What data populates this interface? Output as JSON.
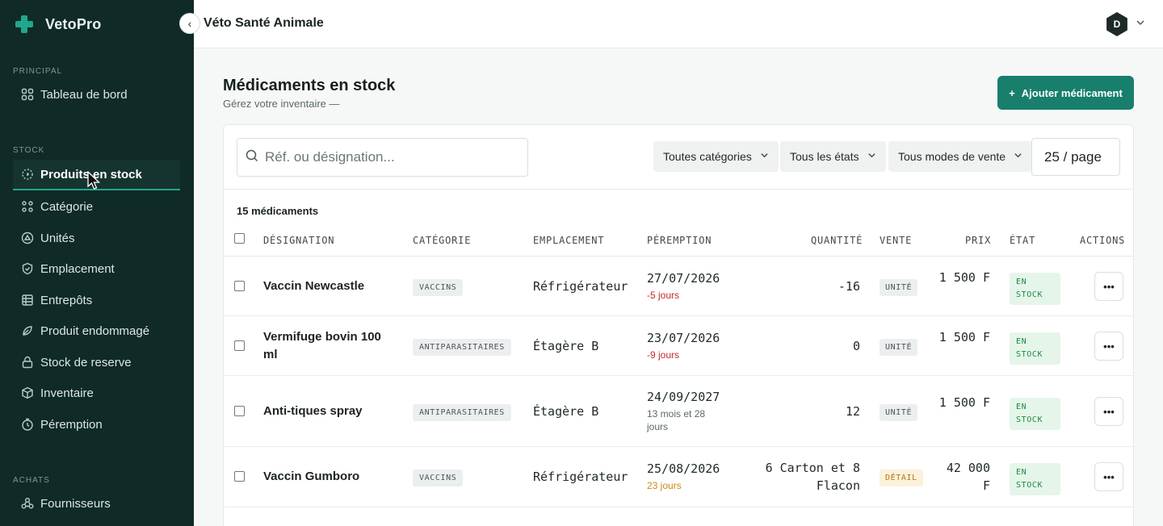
{
  "brand": {
    "name": "VetoPro"
  },
  "topbar": {
    "clinic": "Véto Santé Animale",
    "avatar": "D"
  },
  "sidebar": {
    "sections": [
      {
        "label": "PRINCIPAL",
        "items": [
          {
            "label": "Tableau de bord",
            "icon": "grid-icon"
          }
        ]
      },
      {
        "label": "STOCK",
        "items": [
          {
            "label": "Produits en stock",
            "icon": "box-dashed-icon",
            "active": true
          },
          {
            "label": "Catégorie",
            "icon": "dots-grid-icon"
          },
          {
            "label": "Unités",
            "icon": "scale-icon"
          },
          {
            "label": "Emplacement",
            "icon": "location-icon"
          },
          {
            "label": "Entrepôts",
            "icon": "warehouse-icon"
          },
          {
            "label": "Produit endommagé",
            "icon": "broken-icon"
          },
          {
            "label": "Stock de reserve",
            "icon": "lock-icon"
          },
          {
            "label": "Inventaire",
            "icon": "cube-icon"
          },
          {
            "label": "Péremption",
            "icon": "clock-icon"
          }
        ]
      },
      {
        "label": "ACHATS",
        "items": [
          {
            "label": "Fournisseurs",
            "icon": "suppliers-icon"
          }
        ]
      }
    ]
  },
  "page": {
    "title": "Médicaments en stock",
    "subtitle": "Gérez votre inventaire —",
    "add_label": "Ajouter médicament"
  },
  "filters": {
    "search_placeholder": "Réf. ou désignation...",
    "category": "Toutes catégories",
    "state": "Tous les états",
    "sale_mode": "Tous modes de vente",
    "per_page": "25 / page"
  },
  "table": {
    "count": "15 médicaments",
    "headers": {
      "designation": "DÉSIGNATION",
      "categorie": "CATÉGORIE",
      "emplacement": "EMPLACEMENT",
      "peremption": "PÉREMPTION",
      "quantite": "QUANTITÉ",
      "vente": "VENTE",
      "prix": "PRIX",
      "etat": "ÉTAT",
      "actions": "ACTIONS"
    },
    "rows": [
      {
        "designation": "Vaccin Newcastle",
        "categorie": "VACCINS",
        "emplacement": "Réfrigérateur",
        "date": "27/07/2026",
        "rel": "-5 jours",
        "rel_kind": "neg",
        "quantite": "-16",
        "vente": "UNITÉ",
        "vente_kind": "unit",
        "prix": "1 500 F",
        "etat": "EN STOCK"
      },
      {
        "designation": "Vermifuge bovin 100 ml",
        "categorie": "ANTIPARASITAIRES",
        "emplacement": "Étagère B",
        "date": "23/07/2026",
        "rel": "-9 jours",
        "rel_kind": "neg",
        "quantite": "0",
        "vente": "UNITÉ",
        "vente_kind": "unit",
        "prix": "1 500 F",
        "etat": "EN STOCK"
      },
      {
        "designation": "Anti-tiques spray",
        "categorie": "ANTIPARASITAIRES",
        "emplacement": "Étagère B",
        "date": "24/09/2027",
        "rel": "13 mois et 28 jours",
        "rel_kind": "neutral",
        "quantite": "12",
        "vente": "UNITÉ",
        "vente_kind": "unit",
        "prix": "1 500 F",
        "etat": "EN STOCK"
      },
      {
        "designation": "Vaccin Gumboro",
        "categorie": "VACCINS",
        "emplacement": "Réfrigérateur",
        "date": "25/08/2026",
        "rel": "23 jours",
        "rel_kind": "warn",
        "quantite": "6 Carton et 8 Flacon",
        "vente": "DÉTAIL",
        "vente_kind": "detail",
        "prix": "42 000 F",
        "etat": "EN STOCK"
      }
    ]
  },
  "colors": {
    "sidebar_bg": "#0f2a27",
    "accent": "#177f6c",
    "stock_ok": "#1f8a43",
    "expired": "#c62828",
    "warning": "#c98a12"
  }
}
